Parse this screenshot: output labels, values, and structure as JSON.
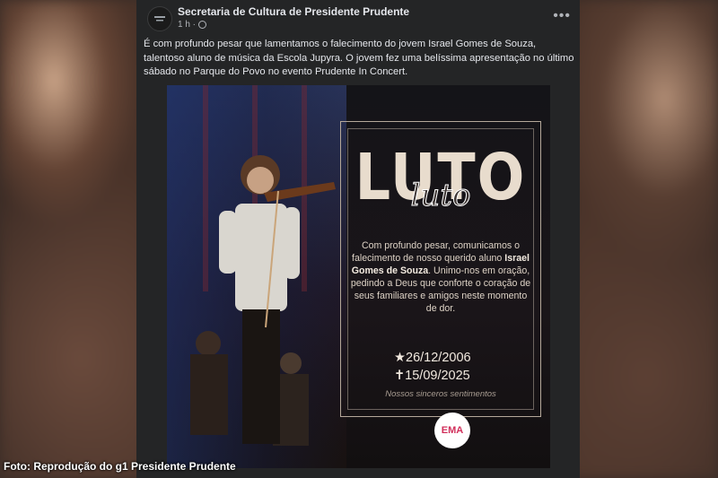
{
  "post": {
    "page_name": "Secretaria de Cultura de Presidente Prudente",
    "time": "1 h ·",
    "body": "É com profundo pesar que lamentamos o falecimento do jovem Israel Gomes de Souza, talentoso aluno de música da Escola Jupyra. O jovem fez uma belíssima apresentação no último sábado no Parque do Povo no evento Prudente In Concert."
  },
  "poster": {
    "title": "LUTO",
    "script_title": "luto",
    "message_before": "Com profundo pesar, comunicamos o falecimento de nosso querido aluno",
    "name": "Israel Gomes de Souza",
    "message_after": ". Unimo-nos em oração, pedindo a Deus que conforte o coração de seus familiares e amigos neste momento de dor.",
    "birth": "26/12/2006",
    "death": "15/09/2025",
    "birth_symbol": "★",
    "death_symbol": "✝",
    "sentiments": "Nossos sinceros sentimentos",
    "logo": "EMA"
  },
  "caption": "Foto: Reprodução do g1 Presidente Prudente",
  "icons": {
    "more": "more-options-icon",
    "globe": "globe-icon"
  },
  "colors": {
    "card_bg": "#242526",
    "text": "#e4e6eb",
    "muted": "#b0b3b8"
  }
}
